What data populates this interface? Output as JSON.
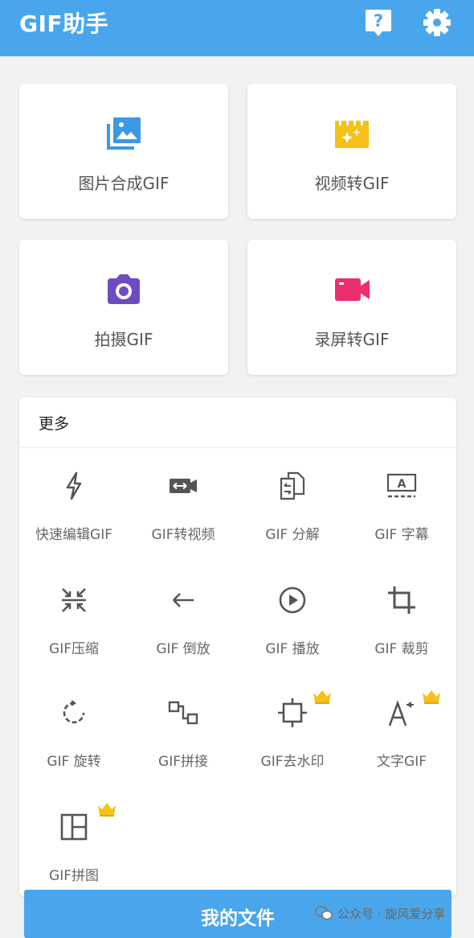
{
  "header": {
    "title": "GIF助手",
    "bg_color": "#4aa6ec"
  },
  "cards": [
    {
      "label": "图片合成GIF",
      "icon": "image-gallery-icon",
      "color": "#3b98e4"
    },
    {
      "label": "视频转GIF",
      "icon": "movie-clapper-icon",
      "color": "#f6c21a"
    },
    {
      "label": "拍摄GIF",
      "icon": "camera-icon",
      "color": "#6e4bc3"
    },
    {
      "label": "录屏转GIF",
      "icon": "video-camera-icon",
      "color": "#ea2f6c"
    }
  ],
  "more": {
    "title": "更多",
    "tools": [
      {
        "label": "快速编辑GIF",
        "icon": "lightning-icon",
        "premium": false
      },
      {
        "label": "GIF转视频",
        "icon": "video-convert-icon",
        "premium": false
      },
      {
        "label": "GIF 分解",
        "icon": "split-files-icon",
        "premium": false
      },
      {
        "label": "GIF 字幕",
        "icon": "subtitle-icon",
        "premium": false
      },
      {
        "label": "GIF压缩",
        "icon": "compress-icon",
        "premium": false
      },
      {
        "label": "GIF 倒放",
        "icon": "arrow-left-icon",
        "premium": false
      },
      {
        "label": "GIF 播放",
        "icon": "play-circle-icon",
        "premium": false
      },
      {
        "label": "GIF 裁剪",
        "icon": "crop-icon",
        "premium": false
      },
      {
        "label": "GIF 旋转",
        "icon": "rotate-icon",
        "premium": false
      },
      {
        "label": "GIF拼接",
        "icon": "join-icon",
        "premium": false
      },
      {
        "label": "GIF去水印",
        "icon": "watermark-remove-icon",
        "premium": true
      },
      {
        "label": "文字GIF",
        "icon": "text-icon",
        "premium": true
      },
      {
        "label": "GIF拼图",
        "icon": "collage-icon",
        "premium": true
      }
    ]
  },
  "footer": {
    "button_label": "我的文件",
    "watermark": "公众号 · 旋风爱分享"
  }
}
